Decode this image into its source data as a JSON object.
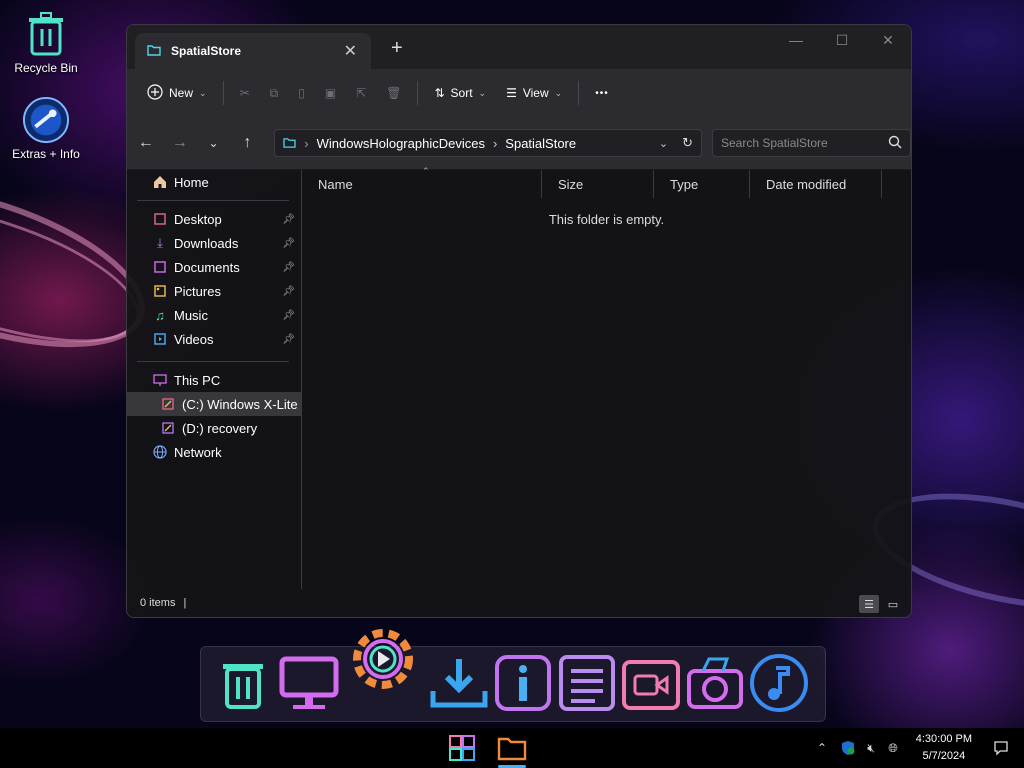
{
  "desktop": {
    "icons": [
      {
        "label": "Recycle Bin",
        "icon": "recycle-bin-icon"
      },
      {
        "label": "Extras + Info",
        "icon": "extras-info-icon"
      }
    ]
  },
  "window": {
    "tab_title": "SpatialStore",
    "toolbar": {
      "new_label": "New",
      "sort_label": "Sort",
      "view_label": "View",
      "more_label": "•••"
    },
    "address": {
      "crumbs": [
        "WindowsHolographicDevices",
        "SpatialStore"
      ],
      "separator": "›"
    },
    "search": {
      "placeholder": "Search SpatialStore"
    },
    "sidebar": {
      "home": "Home",
      "quick_access": [
        {
          "label": "Desktop",
          "icon": "desktop-icon",
          "color": "#e86b8c"
        },
        {
          "label": "Downloads",
          "icon": "downloads-icon",
          "color": "#b07cf0"
        },
        {
          "label": "Documents",
          "icon": "documents-icon",
          "color": "#d36ef2"
        },
        {
          "label": "Pictures",
          "icon": "pictures-icon",
          "color": "#e8c450"
        },
        {
          "label": "Music",
          "icon": "music-icon",
          "color": "#4fe3a1"
        },
        {
          "label": "Videos",
          "icon": "videos-icon",
          "color": "#4ab0f2"
        }
      ],
      "this_pc": "This PC",
      "drives": [
        {
          "label": "(C:) Windows X-Lite",
          "icon": "drive-c-icon",
          "selected": true
        },
        {
          "label": "(D:) recovery",
          "icon": "drive-d-icon",
          "selected": false
        }
      ],
      "network": "Network"
    },
    "columns": [
      "Name",
      "Size",
      "Type",
      "Date modified"
    ],
    "empty_message": "This folder is empty.",
    "status": "0 items"
  },
  "dock": {
    "items": [
      {
        "name": "recycle-bin-icon",
        "color": "#4fe3c8"
      },
      {
        "name": "monitor-icon",
        "color": "#d46cf0"
      },
      {
        "name": "settings-gear-icon",
        "color": "#f28a3c"
      },
      {
        "name": "download-icon",
        "color": "#3aa6f0"
      },
      {
        "name": "info-icon",
        "color": "#c274f0"
      },
      {
        "name": "notes-icon",
        "color": "#b98cf0"
      },
      {
        "name": "video-camera-icon",
        "color": "#f07cb0"
      },
      {
        "name": "camera-icon",
        "color": "#d46cf0"
      },
      {
        "name": "music-icon",
        "color": "#3a8cf0"
      }
    ]
  },
  "taskbar": {
    "apps": [
      {
        "name": "start-icon"
      },
      {
        "name": "file-explorer-icon"
      }
    ],
    "clock": {
      "time": "4:30:00 PM",
      "date": "5/7/2024"
    }
  }
}
